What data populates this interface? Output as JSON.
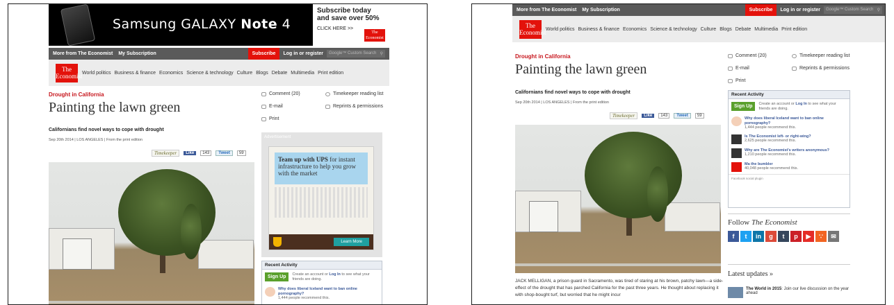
{
  "ad": {
    "brand_light": "Samsung GALAXY ",
    "brand_bold": "Note",
    "brand_suffix": " 4",
    "subscribe_title": "Subscribe today and save over 50%",
    "click_here": "CLICK HERE >>",
    "mini_logo": "The Economist"
  },
  "nav": {
    "more_from": "More from The Economist",
    "my_subscription": "My Subscription",
    "subscribe": "Subscribe",
    "login": "Log in or register",
    "search_placeholder": "Google™ Custom Search",
    "search_icon": "magnifier"
  },
  "logo": {
    "line1": "The",
    "line2": "Economist"
  },
  "menu": [
    "World politics",
    "Business & finance",
    "Economics",
    "Science & technology",
    "Culture",
    "Blogs",
    "Debate",
    "Multimedia",
    "Print edition"
  ],
  "article": {
    "kicker": "Drought in California",
    "headline": "Painting the lawn green",
    "rubric": "Californians find novel ways to cope with drought",
    "dateline": "Sep 20th 2014 | LOS ANGELES | From the print edition",
    "timekeeper": "Timekeeper",
    "like": "Like",
    "like_count": "143",
    "tweet": "Tweet",
    "tweet_count": "59",
    "body": "JACK MELLIGAN, a prison guard in Sacramento, was tired of staring at his brown, patchy lawn—a side-effect of the drought that has parched California for the past three years. He thought about replacing it with shop-bought turf, but worried that he might incur"
  },
  "tools": {
    "comment": "Comment (20)",
    "timekeeper_list": "Timekeeper reading list",
    "email": "E-mail",
    "reprints": "Reprints & permissions",
    "print": "Print"
  },
  "advert": {
    "label": "Advertisement",
    "headline_bold": "Team up with UPS",
    "headline_rest": " for instant infrastructure to help you grow with the market",
    "learn_more": "Learn More"
  },
  "recent_activity": {
    "title": "Recent Activity",
    "signup": "Sign Up",
    "signup_text_a": "Create an account or ",
    "signup_text_link": "Log In",
    "signup_text_b": " to see what your friends are doing.",
    "items": [
      {
        "title": "Why does liberal Iceland want to ban online pornography?",
        "meta": "1,444 people recommend this."
      },
      {
        "title": "Is The Economist left- or right-wing?",
        "meta": "2,625 people recommend this."
      },
      {
        "title": "Why are The Economist's writers anonymous?",
        "meta": "1,210 people recommend this."
      },
      {
        "title": "Ma the bumbler",
        "meta": "40,048 people recommend this."
      }
    ],
    "fb_plugin": "Facebook social plugin"
  },
  "follow": {
    "label": "Follow ",
    "name": "The Economist",
    "icons": [
      "facebook-icon",
      "twitter-icon",
      "linkedin-icon",
      "googleplus-icon",
      "tumblr-icon",
      "pinterest-icon",
      "youtube-icon",
      "rss-icon",
      "email-icon"
    ]
  },
  "latest": {
    "title": "Latest updates »",
    "item_bold": "The World in 2015",
    "item_rest": ": Join our live discussion on the year ahead"
  },
  "colors": {
    "red": "#e3120b",
    "nav": "#5a5a5a",
    "kicker": "#c7161d",
    "link": "#3b5998",
    "green": "#5aa02c"
  }
}
